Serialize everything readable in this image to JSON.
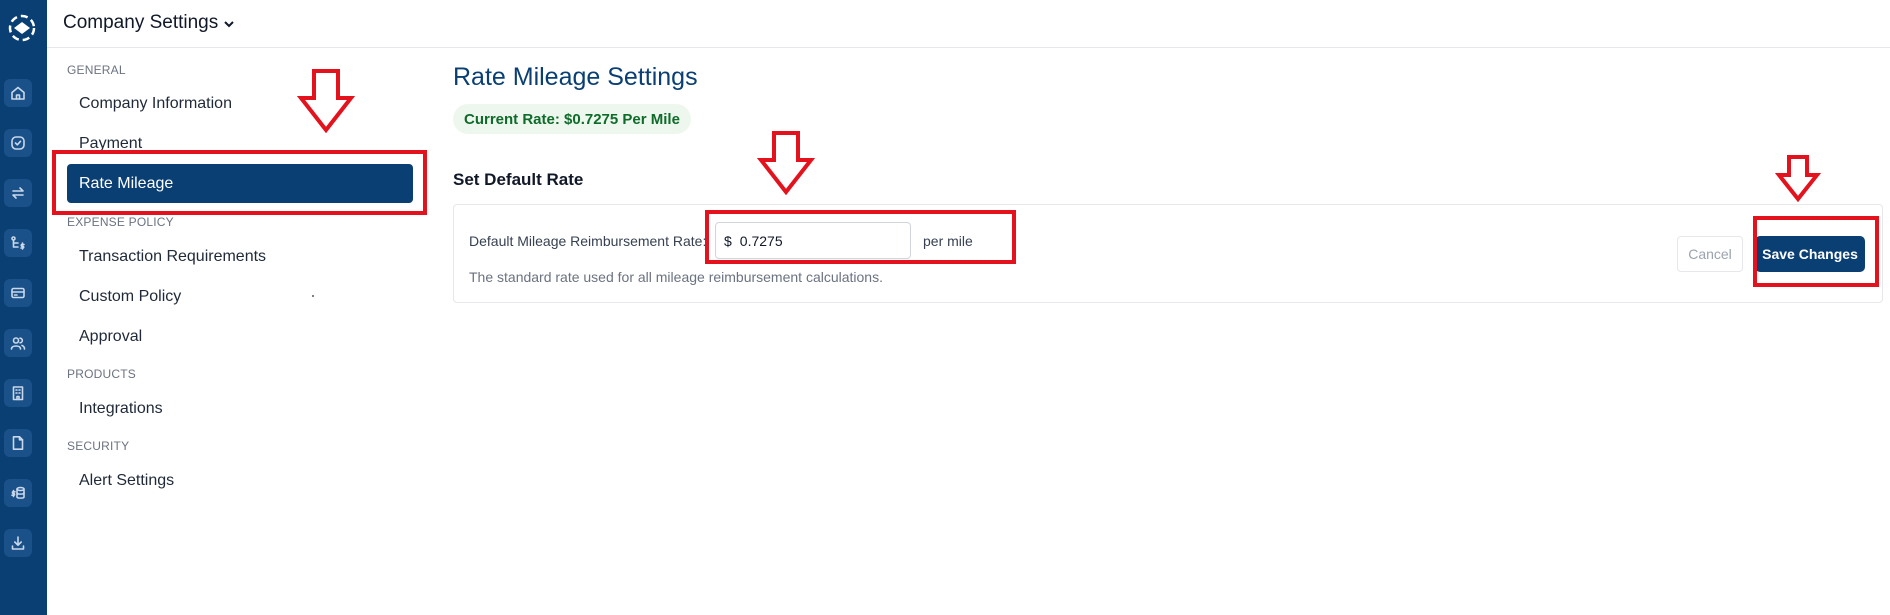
{
  "header": {
    "title": "Company Settings"
  },
  "rail": {
    "items": [
      "home-icon",
      "check-circle-icon",
      "transfer-icon",
      "route-dollar-icon",
      "card-icon",
      "users-icon",
      "building-icon",
      "document-icon",
      "dollar-stack-icon",
      "download-icon"
    ]
  },
  "sidebar": {
    "general": {
      "label": "GENERAL",
      "items": [
        "Company Information",
        "Payment",
        "Rate Mileage"
      ]
    },
    "expense_policy": {
      "label": "EXPENSE POLICY",
      "items": [
        "Transaction Requirements",
        "Custom Policy",
        "Approval"
      ]
    },
    "products": {
      "label": "PRODUCTS",
      "items": [
        "Integrations"
      ]
    },
    "security": {
      "label": "SECURITY",
      "items": [
        "Alert Settings"
      ]
    }
  },
  "main": {
    "title": "Rate Mileage Settings",
    "current_rate": "Current Rate: $0.7275 Per Mile",
    "section_title": "Set Default Rate",
    "field_label": "Default Mileage Reimbursement Rate:",
    "currency": "$",
    "rate_value": "0.7275",
    "unit": "per mile",
    "helper": "The standard rate used for all mileage reimbursement calculations.",
    "cancel_label": "Cancel",
    "save_label": "Save Changes"
  },
  "colors": {
    "brand": "#0a3f73",
    "annotation": "#e3121d",
    "rate_green": "#0f6b2a"
  }
}
